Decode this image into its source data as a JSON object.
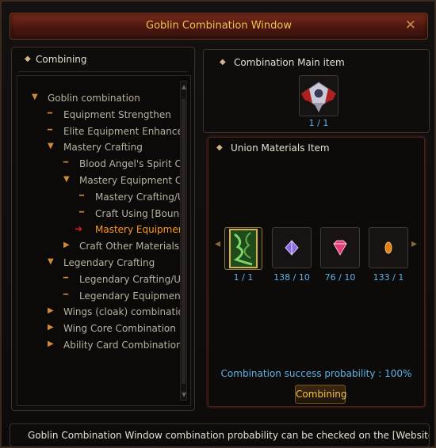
{
  "window": {
    "title": "Goblin Combination Window",
    "close_glyph": "✕"
  },
  "left_panel": {
    "header": "Combining",
    "tree": [
      {
        "label": "Goblin combination",
        "icon": "arrow-down",
        "level": 0
      },
      {
        "label": "Equipment Strengthen",
        "icon": "dash",
        "level": 1
      },
      {
        "label": "Elite Equipment Enhancemer",
        "icon": "dash",
        "level": 1
      },
      {
        "label": "Mastery Crafting",
        "icon": "arrow-down",
        "level": 1
      },
      {
        "label": "Blood Angel's Spirit Craft",
        "icon": "dash",
        "level": 2
      },
      {
        "label": "Mastery Equipment Craft",
        "icon": "arrow-down",
        "level": 2
      },
      {
        "label": "Mastery Crafting/Upg",
        "icon": "dash",
        "level": 3
      },
      {
        "label": "Craft Using [Bound] M",
        "icon": "dash",
        "level": 3
      },
      {
        "label": "Mastery Equipment T",
        "icon": "selected-arrow",
        "level": 3,
        "selected": true
      },
      {
        "label": "Craft Other Materials",
        "icon": "arrow-right",
        "level": 2
      },
      {
        "label": "Legendary Crafting",
        "icon": "arrow-down",
        "level": 1
      },
      {
        "label": "Legendary Crafting/Upgra",
        "icon": "dash",
        "level": 2
      },
      {
        "label": "Legendary Equipment Tra",
        "icon": "dash",
        "level": 2
      },
      {
        "label": "Wings (cloak) combination",
        "icon": "arrow-right",
        "level": 1
      },
      {
        "label": "Wing Core Combination",
        "icon": "arrow-right",
        "level": 1
      },
      {
        "label": "Ability Card Combination",
        "icon": "arrow-right",
        "level": 1
      }
    ]
  },
  "main_item": {
    "header": "Combination Main item",
    "count": "1 / 1",
    "icon": "armor-emblem-icon"
  },
  "materials": {
    "header": "Union Materials Item",
    "items": [
      {
        "count": "1 / 1",
        "icon": "green-scroll-icon"
      },
      {
        "count": "138 / 10",
        "icon": "purple-gem-icon"
      },
      {
        "count": "76 / 10",
        "icon": "pink-gem-icon"
      },
      {
        "count": "133 / 1",
        "icon": "orange-gem-icon"
      }
    ]
  },
  "probability": "Combination success probability : 100%",
  "combine_button": "Combining",
  "notice": "Goblin Combination Window combination probability can be checked on the [Website -",
  "colors": {
    "accent": "#f2c14a",
    "count_blue": "#5fb2e8",
    "selected": "#ff9a1e"
  }
}
